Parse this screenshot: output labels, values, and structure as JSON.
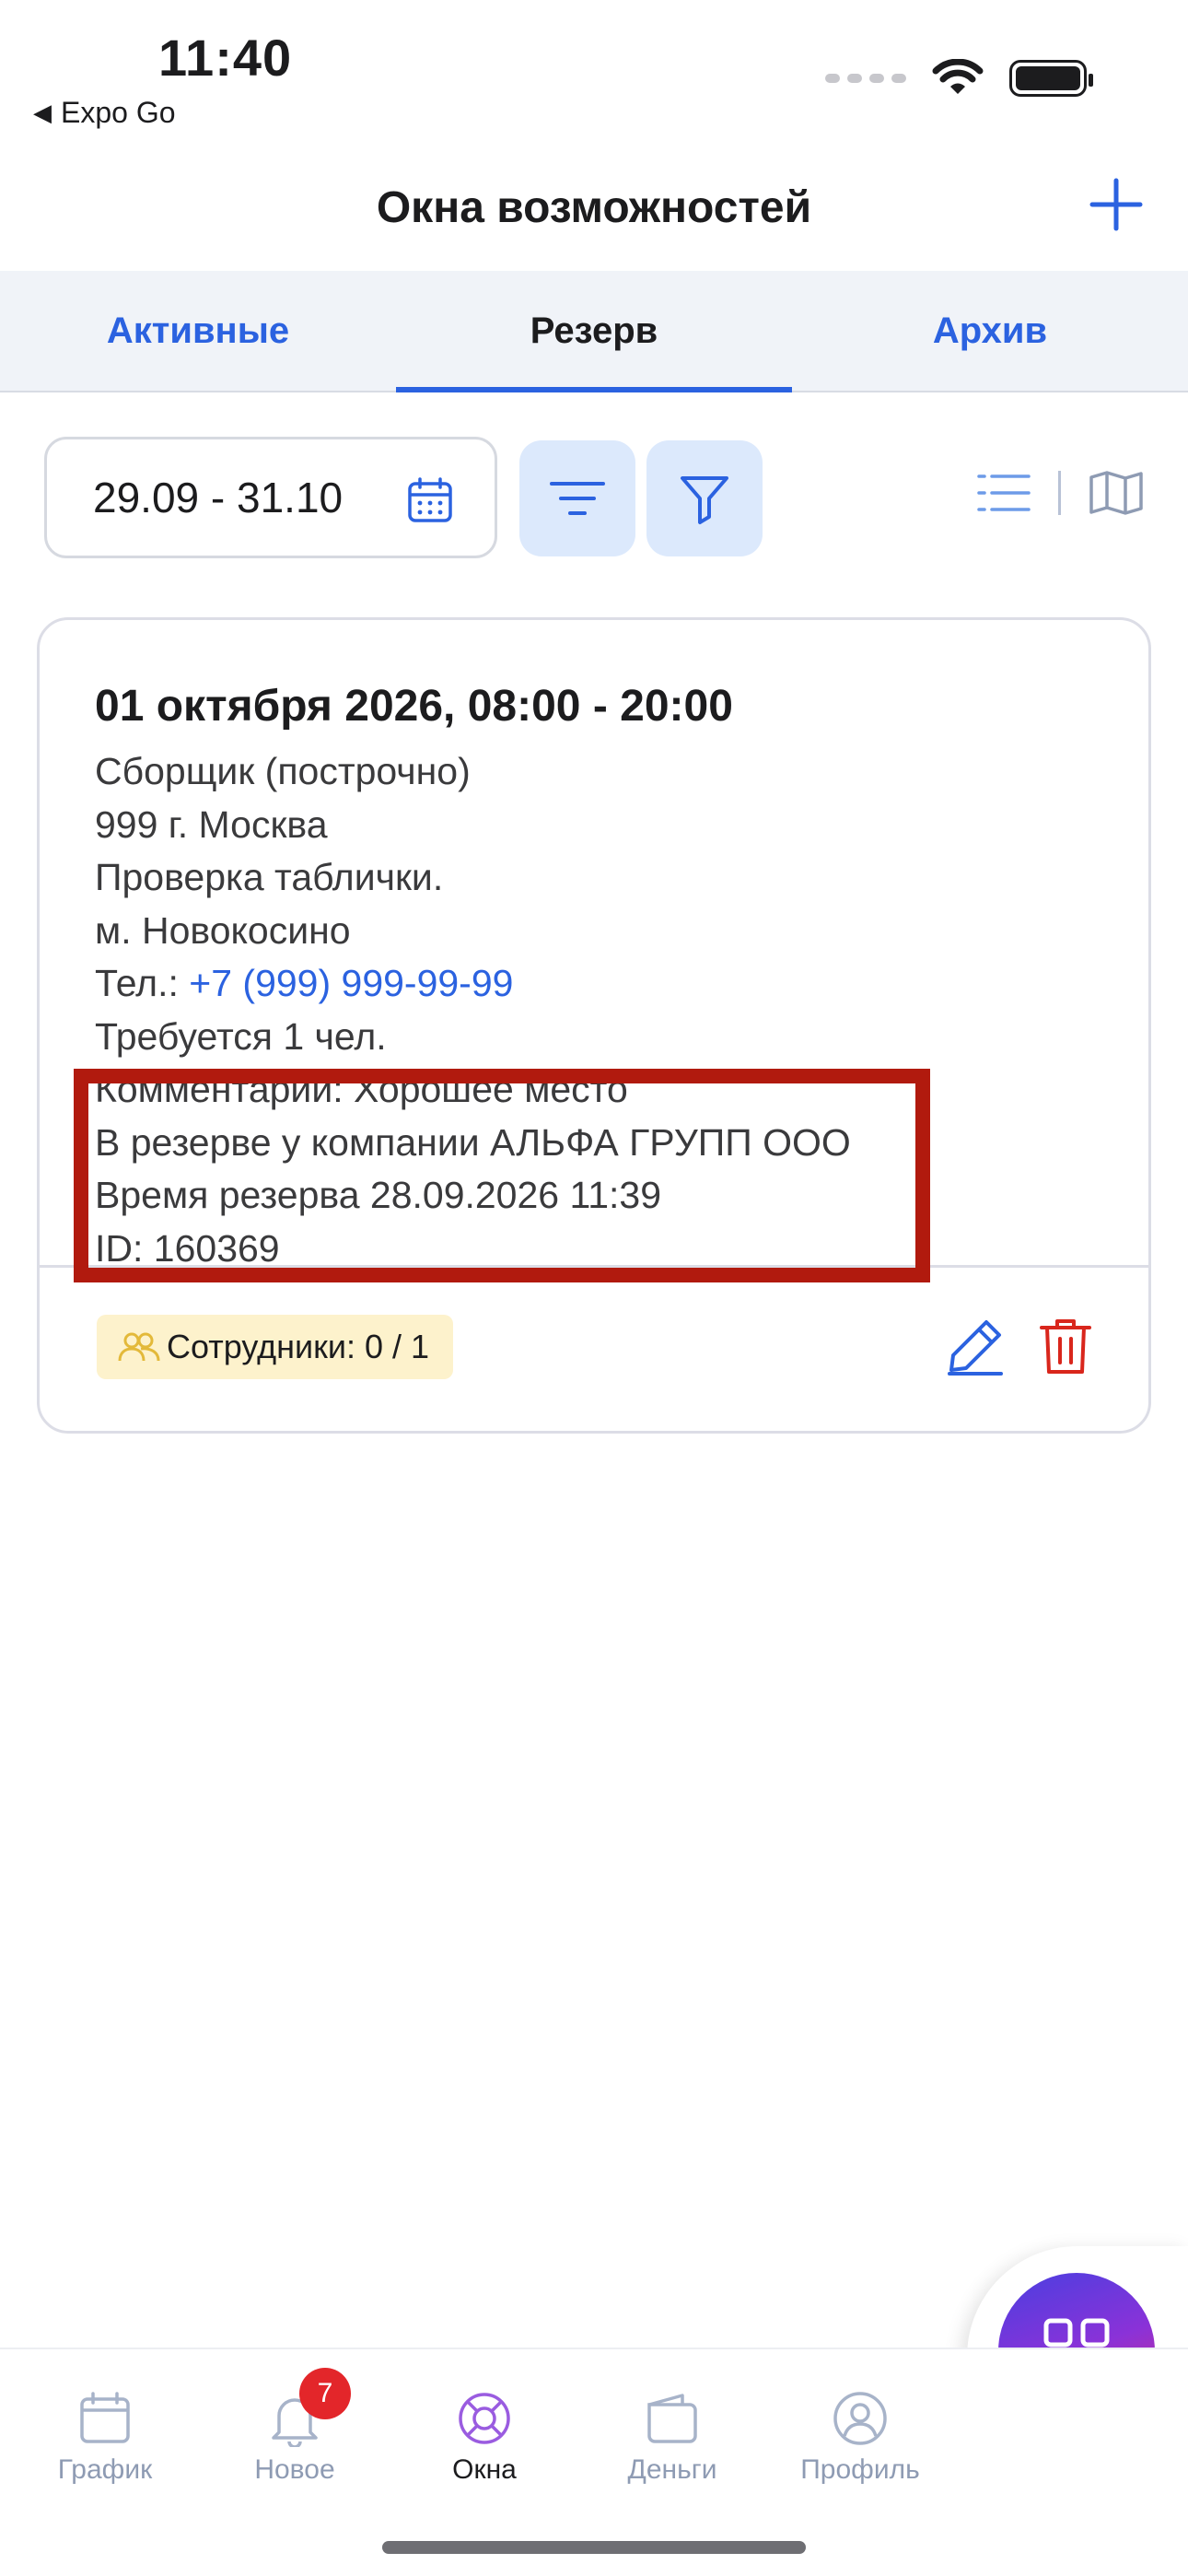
{
  "status_bar": {
    "time": "11:40",
    "back_app": "Expo Go"
  },
  "header": {
    "title": "Окна возможностей",
    "add_icon": "plus-icon"
  },
  "tabs": [
    {
      "label": "Активные",
      "active": false
    },
    {
      "label": "Резерв",
      "active": true
    },
    {
      "label": "Архив",
      "active": false
    }
  ],
  "toolbar": {
    "date_range": "29.09 - 31.10",
    "icons": [
      "calendar-icon",
      "sort-icon",
      "filter-icon",
      "list-view-icon",
      "map-view-icon"
    ]
  },
  "card": {
    "title": "01 октября 2026, 08:00 - 20:00",
    "position": "Сборщик (построчно)",
    "address": "999 г. Москва",
    "note": "Проверка таблички.",
    "metro": "м. Новокосино",
    "phone_label": "Тел.: ",
    "phone": "+7 (999) 999-99-99",
    "required": "Требуется 1 чел.",
    "comment": "Комментарий: Хорошее место",
    "reserved_by": "В резерве у компании АЛЬФА ГРУПП ООО",
    "reserve_time": "Время резерва 28.09.2026 11:39",
    "id": "ID: 160369",
    "employees_badge": "Сотрудники: 0 / 1"
  },
  "bottom_nav": {
    "items": [
      {
        "label": "График",
        "icon": "calendar-icon",
        "active": false
      },
      {
        "label": "Новое",
        "icon": "bell-icon",
        "active": false,
        "badge": "7"
      },
      {
        "label": "Окна",
        "icon": "lifebuoy-icon",
        "active": true
      },
      {
        "label": "Деньги",
        "icon": "wallet-icon",
        "active": false
      },
      {
        "label": "Профиль",
        "icon": "user-icon",
        "active": false
      }
    ]
  },
  "fab": {
    "icon": "qr-code-icon"
  },
  "colors": {
    "accent": "#2b62e0",
    "danger": "#d9261c",
    "highlight_border": "#b11a0e",
    "badge_bg": "#fdf2cc",
    "active_nav": "#8a4fd8"
  }
}
